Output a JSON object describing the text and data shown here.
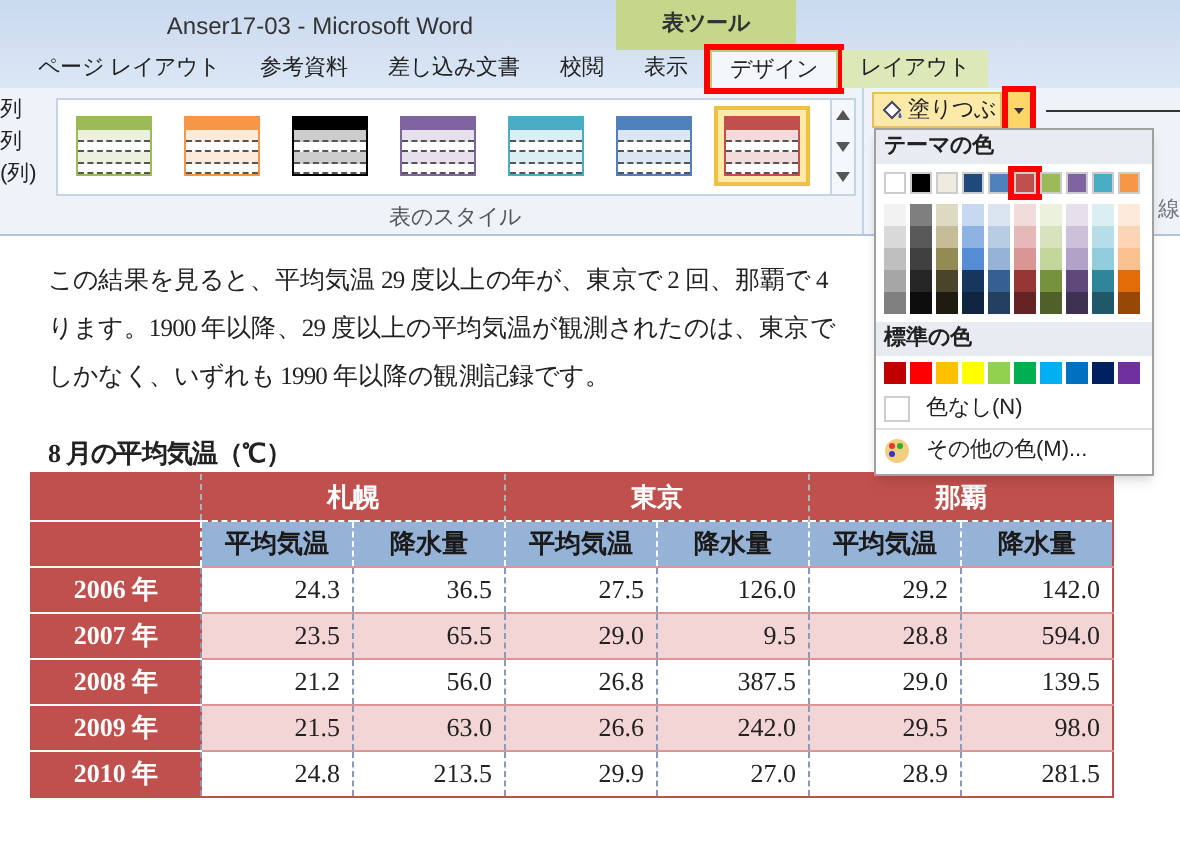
{
  "window": {
    "title": "Anser17-03  -  Microsoft Word",
    "context_tab_group": "表ツール"
  },
  "tabs": [
    {
      "label": "ページ レイアウト",
      "selected": false,
      "highlighted": false,
      "contextual": false
    },
    {
      "label": "参考資料",
      "selected": false,
      "highlighted": false,
      "contextual": false
    },
    {
      "label": "差し込み文書",
      "selected": false,
      "highlighted": false,
      "contextual": false
    },
    {
      "label": "校閲",
      "selected": false,
      "highlighted": false,
      "contextual": false
    },
    {
      "label": "表示",
      "selected": false,
      "highlighted": false,
      "contextual": false
    },
    {
      "label": "デザイン",
      "selected": true,
      "highlighted": true,
      "contextual": true
    },
    {
      "label": "レイアウト",
      "selected": false,
      "highlighted": false,
      "contextual": true
    }
  ],
  "ribbon": {
    "left_options": [
      "列",
      "列",
      "(列)"
    ],
    "table_styles": {
      "label": "表のスタイル",
      "items": [
        {
          "color": "#9bbb59",
          "selected": false
        },
        {
          "color": "#f79646",
          "selected": false
        },
        {
          "color": "#000000",
          "selected": false
        },
        {
          "color": "#8064a2",
          "selected": false
        },
        {
          "color": "#4bacc6",
          "selected": false
        },
        {
          "color": "#4f81bd",
          "selected": false
        },
        {
          "color": "#c0504d",
          "selected": true
        }
      ]
    },
    "fill_button": {
      "label": "塗りつぶ",
      "arrow_highlighted": true
    },
    "right_group_label": "線"
  },
  "color_menu": {
    "theme_heading": "テーマの色",
    "theme_colors": [
      {
        "color": "#ffffff",
        "selected": false,
        "shades": [
          {
            "color": "#f2f2f2"
          },
          {
            "color": "#d9d9d9"
          },
          {
            "color": "#bfbfbf"
          },
          {
            "color": "#a6a6a6"
          },
          {
            "color": "#808080"
          }
        ]
      },
      {
        "color": "#000000",
        "selected": false,
        "shades": [
          {
            "color": "#7f7f7f"
          },
          {
            "color": "#595959"
          },
          {
            "color": "#404040"
          },
          {
            "color": "#262626"
          },
          {
            "color": "#0d0d0d"
          }
        ]
      },
      {
        "color": "#eeece1",
        "selected": false,
        "shades": [
          {
            "color": "#ddd9c3"
          },
          {
            "color": "#c4bd97"
          },
          {
            "color": "#948a54"
          },
          {
            "color": "#4a452a"
          },
          {
            "color": "#1e1c11"
          }
        ]
      },
      {
        "color": "#1f497d",
        "selected": false,
        "shades": [
          {
            "color": "#c6d9f0"
          },
          {
            "color": "#8db3e2"
          },
          {
            "color": "#548dd4"
          },
          {
            "color": "#17365d"
          },
          {
            "color": "#0f243e"
          }
        ]
      },
      {
        "color": "#4f81bd",
        "selected": false,
        "shades": [
          {
            "color": "#dbe5f1"
          },
          {
            "color": "#b8cce4"
          },
          {
            "color": "#95b3d7"
          },
          {
            "color": "#366092"
          },
          {
            "color": "#244061"
          }
        ]
      },
      {
        "color": "#c0504d",
        "selected": true,
        "shades": [
          {
            "color": "#f2dcdb"
          },
          {
            "color": "#e5b9b7"
          },
          {
            "color": "#d99694"
          },
          {
            "color": "#953734"
          },
          {
            "color": "#632423"
          }
        ]
      },
      {
        "color": "#9bbb59",
        "selected": false,
        "shades": [
          {
            "color": "#ebf1dd"
          },
          {
            "color": "#d7e3bc"
          },
          {
            "color": "#c3d69b"
          },
          {
            "color": "#76923c"
          },
          {
            "color": "#4f6128"
          }
        ]
      },
      {
        "color": "#8064a2",
        "selected": false,
        "shades": [
          {
            "color": "#e5e0ec"
          },
          {
            "color": "#ccc1d9"
          },
          {
            "color": "#b2a2c7"
          },
          {
            "color": "#5f497a"
          },
          {
            "color": "#3f3151"
          }
        ]
      },
      {
        "color": "#4bacc6",
        "selected": false,
        "shades": [
          {
            "color": "#dbeef3"
          },
          {
            "color": "#b7dde8"
          },
          {
            "color": "#92cddc"
          },
          {
            "color": "#31859b"
          },
          {
            "color": "#205867"
          }
        ]
      },
      {
        "color": "#f79646",
        "selected": false,
        "shades": [
          {
            "color": "#fdeada"
          },
          {
            "color": "#fbd5b5"
          },
          {
            "color": "#fac08f"
          },
          {
            "color": "#e36c09"
          },
          {
            "color": "#974806"
          }
        ]
      }
    ],
    "standard_heading": "標準の色",
    "standard_colors": [
      {
        "color": "#c00000"
      },
      {
        "color": "#ff0000"
      },
      {
        "color": "#ffc000"
      },
      {
        "color": "#ffff00"
      },
      {
        "color": "#92d050"
      },
      {
        "color": "#00b050"
      },
      {
        "color": "#00b0f0"
      },
      {
        "color": "#0070c0"
      },
      {
        "color": "#002060"
      },
      {
        "color": "#7030a0"
      }
    ],
    "no_color": "色なし(N)",
    "more_colors": "その他の色(M)..."
  },
  "document": {
    "paragraph": [
      "この結果を見ると、平均気温 29 度以上の年が、東京で 2 回、那覇で 4",
      "ります。1900 年以降、29 度以上の平均気温が観測されたのは、東京で",
      "しかなく、いずれも 1990 年以降の観測記録です。"
    ],
    "table_title": "8 月の平均気温（℃）",
    "table": {
      "cities": [
        "札幌",
        "東京",
        "那覇"
      ],
      "subheaders": [
        "平均気温",
        "降水量",
        "平均気温",
        "降水量",
        "平均気温",
        "降水量"
      ],
      "rows": [
        {
          "year": "2006 年",
          "cells": [
            "24.3",
            "36.5",
            "27.5",
            "126.0",
            "29.2",
            "142.0"
          ]
        },
        {
          "year": "2007 年",
          "cells": [
            "23.5",
            "65.5",
            "29.0",
            "9.5",
            "28.8",
            "594.0"
          ]
        },
        {
          "year": "2008 年",
          "cells": [
            "21.2",
            "56.0",
            "26.8",
            "387.5",
            "29.0",
            "139.5"
          ]
        },
        {
          "year": "2009 年",
          "cells": [
            "21.5",
            "63.0",
            "26.6",
            "242.0",
            "29.5",
            "98.0"
          ]
        },
        {
          "year": "2010 年",
          "cells": [
            "24.8",
            "213.5",
            "29.9",
            "27.0",
            "28.9",
            "281.5"
          ]
        }
      ]
    }
  }
}
